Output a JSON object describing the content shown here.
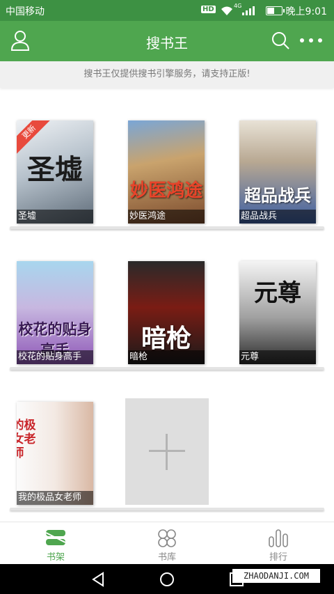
{
  "status_bar": {
    "carrier": "中国移动",
    "network": "4G",
    "hd": "HD",
    "battery_level": 0.55,
    "time": "晚上9:01"
  },
  "app_bar": {
    "title": "搜书王"
  },
  "notice": "搜书王仅提供搜书引擎服务，请支持正版!",
  "books": [
    {
      "title": "圣墟",
      "cover_text": "圣墟",
      "badge": "更新"
    },
    {
      "title": "妙医鸿途",
      "cover_text": "妙医鸿途"
    },
    {
      "title": "超品战兵",
      "cover_text": "超品战兵"
    },
    {
      "title": "校花的贴身高手",
      "cover_text": "校花的贴身高手"
    },
    {
      "title": "暗枪",
      "cover_text": "暗枪"
    },
    {
      "title": "元尊",
      "cover_text": "元尊"
    },
    {
      "title": "我的极品女老师",
      "cover_text": "我的极品女老师"
    }
  ],
  "tabs": [
    {
      "label": "书架",
      "icon": "bookshelf-icon",
      "active": true
    },
    {
      "label": "书库",
      "icon": "library-icon",
      "active": false
    },
    {
      "label": "排行",
      "icon": "ranking-icon",
      "active": false
    }
  ],
  "watermark": "ZHAODANJI.COM",
  "colors": {
    "status_bar": "#3d9143",
    "app_bar": "#4fa64f",
    "badge": "#e84a3d",
    "tab_active": "#4fa64f"
  }
}
